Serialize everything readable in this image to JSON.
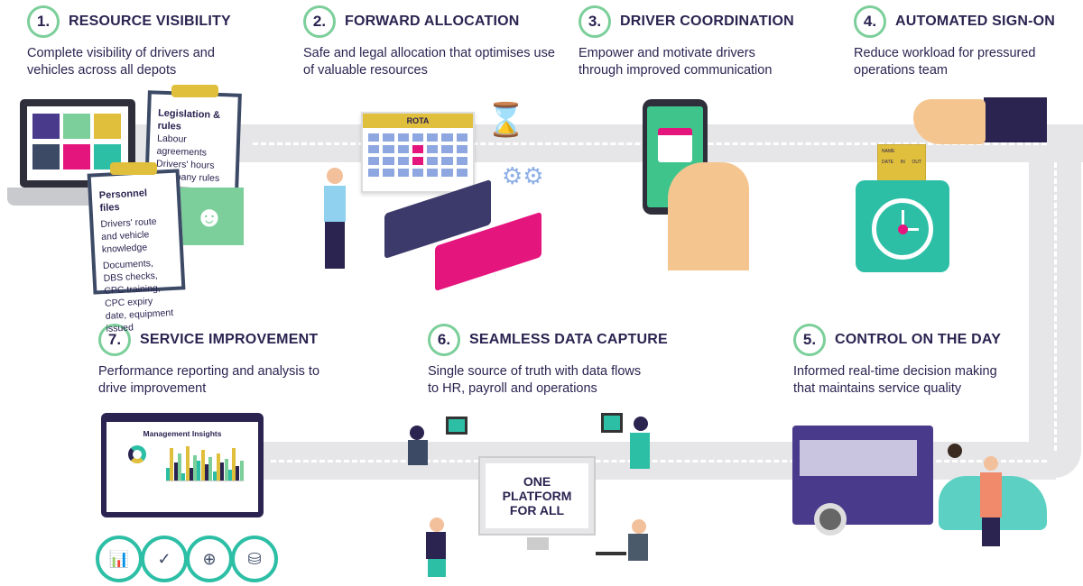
{
  "steps": [
    {
      "num": "1.",
      "title": "RESOURCE VISIBILITY",
      "desc": "Complete visibility of drivers and vehicles across all depots"
    },
    {
      "num": "2.",
      "title": "FORWARD ALLOCATION",
      "desc": "Safe and legal allocation that optimises use of valuable resources"
    },
    {
      "num": "3.",
      "title": "DRIVER COORDINATION",
      "desc": "Empower and motivate drivers through improved communication"
    },
    {
      "num": "4.",
      "title": "AUTOMATED SIGN-ON",
      "desc": "Reduce workload for pressured operations team"
    },
    {
      "num": "5.",
      "title": "CONTROL ON THE DAY",
      "desc": "Informed real-time decision making that maintains service quality"
    },
    {
      "num": "6.",
      "title": "SEAMLESS DATA CAPTURE",
      "desc": "Single source of truth with data flows to HR, payroll and operations"
    },
    {
      "num": "7.",
      "title": "SERVICE IMPROVEMENT",
      "desc": "Performance reporting and analysis to drive improvement"
    }
  ],
  "clipboards": {
    "legislation": {
      "title": "Legislation & rules",
      "items": [
        "Labour agreements",
        "Drivers' hours",
        "Company rules"
      ]
    },
    "personnel": {
      "title": "Personnel files",
      "items": [
        "Drivers' route and vehicle knowledge",
        "Documents, DBS checks, CPC training, CPC expiry date, equipment issued"
      ]
    }
  },
  "calendar_label": "ROTA",
  "timecard": {
    "name": "NAME",
    "cols": [
      "DATE",
      "IN",
      "OUT"
    ]
  },
  "insights_title": "Management Insights",
  "platform_text": "ONE PLATFORM FOR ALL",
  "colors": {
    "text": "#2b2350",
    "accent_green": "#7ccf9a",
    "teal": "#2dbfa6",
    "road": "#e6e6e8",
    "purple": "#4a3a8c",
    "pink": "#e5157e",
    "yellow": "#e0bf3c"
  }
}
